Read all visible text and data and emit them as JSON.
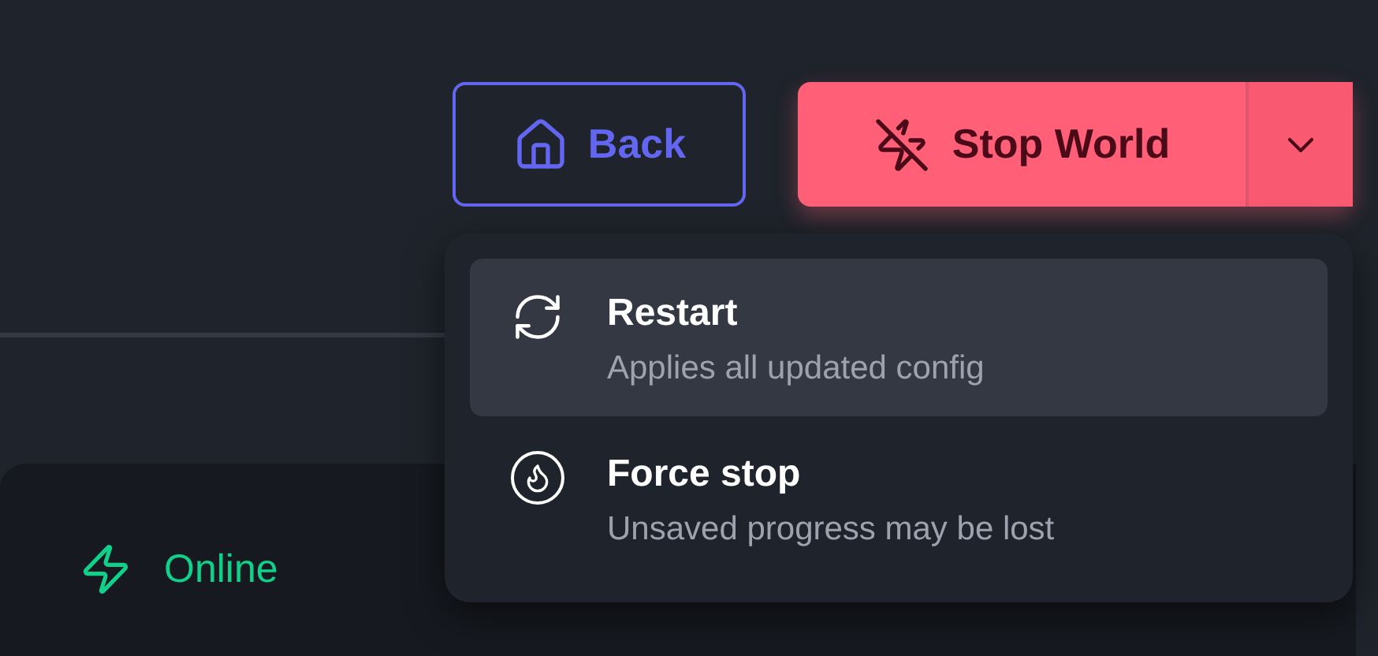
{
  "buttons": {
    "back": {
      "label": "Back"
    },
    "stop": {
      "label": "Stop World",
      "menu_expanded": true
    }
  },
  "menu": {
    "items": [
      {
        "kind": "restart",
        "title": "Restart",
        "subtitle": "Applies all updated config",
        "selected": true
      },
      {
        "kind": "force",
        "title": "Force stop",
        "subtitle": "Unsaved progress may be lost",
        "selected": false
      }
    ]
  },
  "status": {
    "label": "Online"
  }
}
